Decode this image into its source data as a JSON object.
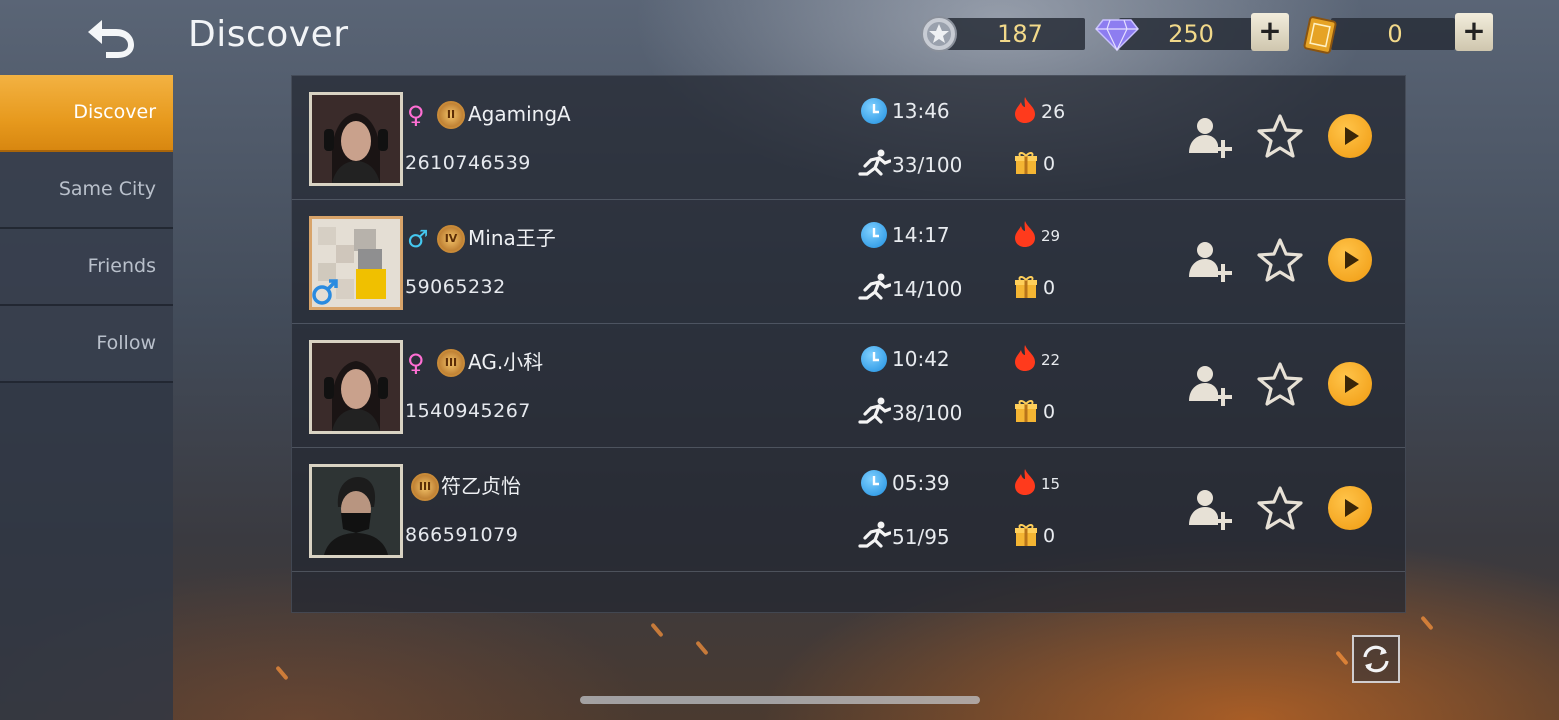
{
  "header": {
    "title": "Discover"
  },
  "resources": [
    {
      "icon": "silver-coin-icon",
      "value": "187",
      "has_plus": false
    },
    {
      "icon": "diamond-icon",
      "value": "250",
      "has_plus": true,
      "plus_label": "+"
    },
    {
      "icon": "ticket-card-icon",
      "value": "0",
      "has_plus": true,
      "plus_label": "+"
    }
  ],
  "sidebar": {
    "items": [
      {
        "label": "Discover",
        "active": true
      },
      {
        "label": "Same City",
        "active": false
      },
      {
        "label": "Friends",
        "active": false
      },
      {
        "label": "Follow",
        "active": false
      }
    ]
  },
  "players": [
    {
      "gender": "♀",
      "gender_color": "#ff6fd4",
      "rank": "II",
      "name": "AgamingA",
      "id": "2610746539",
      "time": "13:46",
      "progress": "33/100",
      "heat": "26",
      "gifts": "0",
      "avatar": "female-soldier-avatar"
    },
    {
      "gender": "♂",
      "gender_color": "#45c8f0",
      "rank": "IV",
      "name": "Mina王子",
      "id": "59065232",
      "time": "14:17",
      "progress": "14/100",
      "heat": "29",
      "gifts": "0",
      "avatar": "blurred-photo-avatar"
    },
    {
      "gender": "♀",
      "gender_color": "#ff6fd4",
      "rank": "III",
      "name": "AG.小科",
      "id": "1540945267",
      "time": "10:42",
      "progress": "38/100",
      "heat": "22",
      "gifts": "0",
      "avatar": "female-soldier-avatar"
    },
    {
      "gender": "",
      "gender_color": "#ffffff",
      "rank": "III",
      "name": "符乙贞怡",
      "id": "866591079",
      "time": "05:39",
      "progress": "51/95",
      "heat": "15",
      "gifts": "0",
      "avatar": "masked-male-avatar"
    }
  ],
  "colors": {
    "accent": "#f0a020",
    "clock": "#2a9de8",
    "heat": "#ff3a1c",
    "gift": "#f4b533"
  }
}
